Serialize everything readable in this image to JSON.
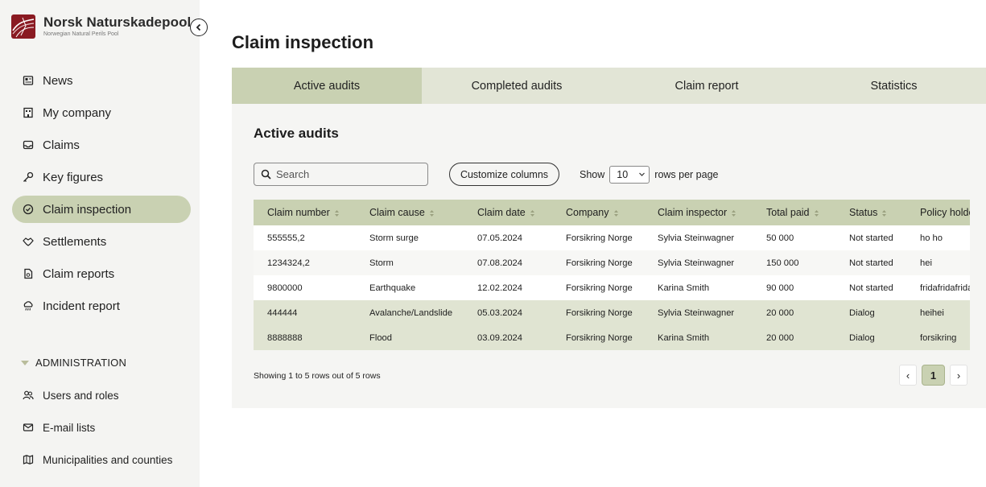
{
  "app": {
    "name": "Norsk Naturskadepool",
    "subtitle": "Norwegian Natural Perils Pool"
  },
  "sidebar": {
    "items": [
      {
        "label": "News",
        "icon": "newspaper-icon"
      },
      {
        "label": "My company",
        "icon": "building-icon"
      },
      {
        "label": "Claims",
        "icon": "inbox-icon"
      },
      {
        "label": "Key figures",
        "icon": "key-icon"
      },
      {
        "label": "Claim inspection",
        "icon": "check-circle-icon",
        "active": true
      },
      {
        "label": "Settlements",
        "icon": "handshake-icon"
      },
      {
        "label": "Claim reports",
        "icon": "document-icon"
      },
      {
        "label": "Incident report",
        "icon": "storm-cloud-icon"
      }
    ],
    "admin_heading": "ADMINISTRATION",
    "admin_items": [
      {
        "label": "Users and roles",
        "icon": "users-icon"
      },
      {
        "label": "E-mail lists",
        "icon": "mail-icon"
      },
      {
        "label": "Municipalities and counties",
        "icon": "map-icon"
      }
    ]
  },
  "page": {
    "title": "Claim inspection",
    "tabs": [
      "Active audits",
      "Completed audits",
      "Claim report",
      "Statistics"
    ],
    "active_tab": 0,
    "section_title": "Active audits"
  },
  "toolbar": {
    "search_placeholder": "Search",
    "customize_label": "Customize columns",
    "show_label": "Show",
    "rows_value": "10",
    "rows_suffix": "rows per page"
  },
  "table": {
    "columns": [
      "Claim number",
      "Claim cause",
      "Claim date",
      "Company",
      "Claim inspector",
      "Total paid",
      "Status",
      "Policy holde"
    ],
    "rows": [
      [
        "555555,2",
        "Storm surge",
        "07.05.2024",
        "Forsikring Norge",
        "Sylvia Steinwagner",
        "50 000",
        "Not started",
        "ho ho"
      ],
      [
        "1234324,2",
        "Storm",
        "07.08.2024",
        "Forsikring Norge",
        "Sylvia Steinwagner",
        "150 000",
        "Not started",
        "hei"
      ],
      [
        "9800000",
        "Earthquake",
        "12.02.2024",
        "Forsikring Norge",
        "Karina Smith",
        "90 000",
        "Not started",
        "fridafridafrida"
      ],
      [
        "444444",
        "Avalanche/Landslide",
        "05.03.2024",
        "Forsikring Norge",
        "Sylvia Steinwagner",
        "20 000",
        "Dialog",
        "heihei"
      ],
      [
        "8888888",
        "Flood",
        "03.09.2024",
        "Forsikring Norge",
        "Karina Smith",
        "20 000",
        "Dialog",
        "forsikring"
      ]
    ]
  },
  "footer": {
    "summary": "Showing 1 to 5 rows out of 5 rows",
    "current_page": "1",
    "prev": "‹",
    "next": "›"
  },
  "colors": {
    "accent": "#c9d1b2",
    "tab_bg": "#e2e5d6",
    "dialog_row": "#e0e4d2",
    "logo": "#8a1a22"
  }
}
